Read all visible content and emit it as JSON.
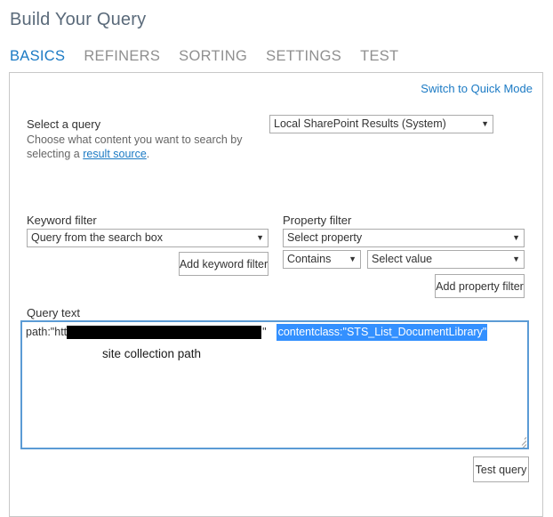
{
  "page": {
    "title": "Build Your Query"
  },
  "tabs": [
    {
      "label": "BASICS",
      "active": true
    },
    {
      "label": "REFINERS",
      "active": false
    },
    {
      "label": "SORTING",
      "active": false
    },
    {
      "label": "SETTINGS",
      "active": false
    },
    {
      "label": "TEST",
      "active": false
    }
  ],
  "panel": {
    "quick_mode_link": "Switch to Quick Mode",
    "select_query": {
      "label": "Select a query",
      "description_part1": "Choose what content you want to search by selecting a ",
      "link_text": "result source",
      "description_part2": ".",
      "source_value": "Local SharePoint Results (System)"
    },
    "keyword_filter": {
      "label": "Keyword filter",
      "value": "Query from the search box",
      "add_button": "Add keyword filter"
    },
    "property_filter": {
      "label": "Property filter",
      "property_value": "Select property",
      "operator_value": "Contains",
      "value_value": "Select value",
      "add_button": "Add property filter"
    },
    "query_text": {
      "label": "Query text",
      "prefix": "path:\"htt",
      "redacted": true,
      "suffix": "\"",
      "selected_text": "contentclass:\"STS_List_DocumentLibrary\"",
      "annotation": "site collection path"
    },
    "test_query_button": "Test query"
  },
  "colors": {
    "accent_blue": "#1b7ac4",
    "title_gray": "#5a6a7a",
    "tab_inactive": "#8f8f8f",
    "selection_blue": "#3390ff",
    "focus_border": "#5b9bd5",
    "redaction_black": "#000000",
    "panel_border": "#c8c8c8",
    "control_border": "#ababab"
  },
  "icons": {
    "dropdown_arrow": "chevron-down-icon",
    "resize_grip": "resize-grip-icon"
  }
}
